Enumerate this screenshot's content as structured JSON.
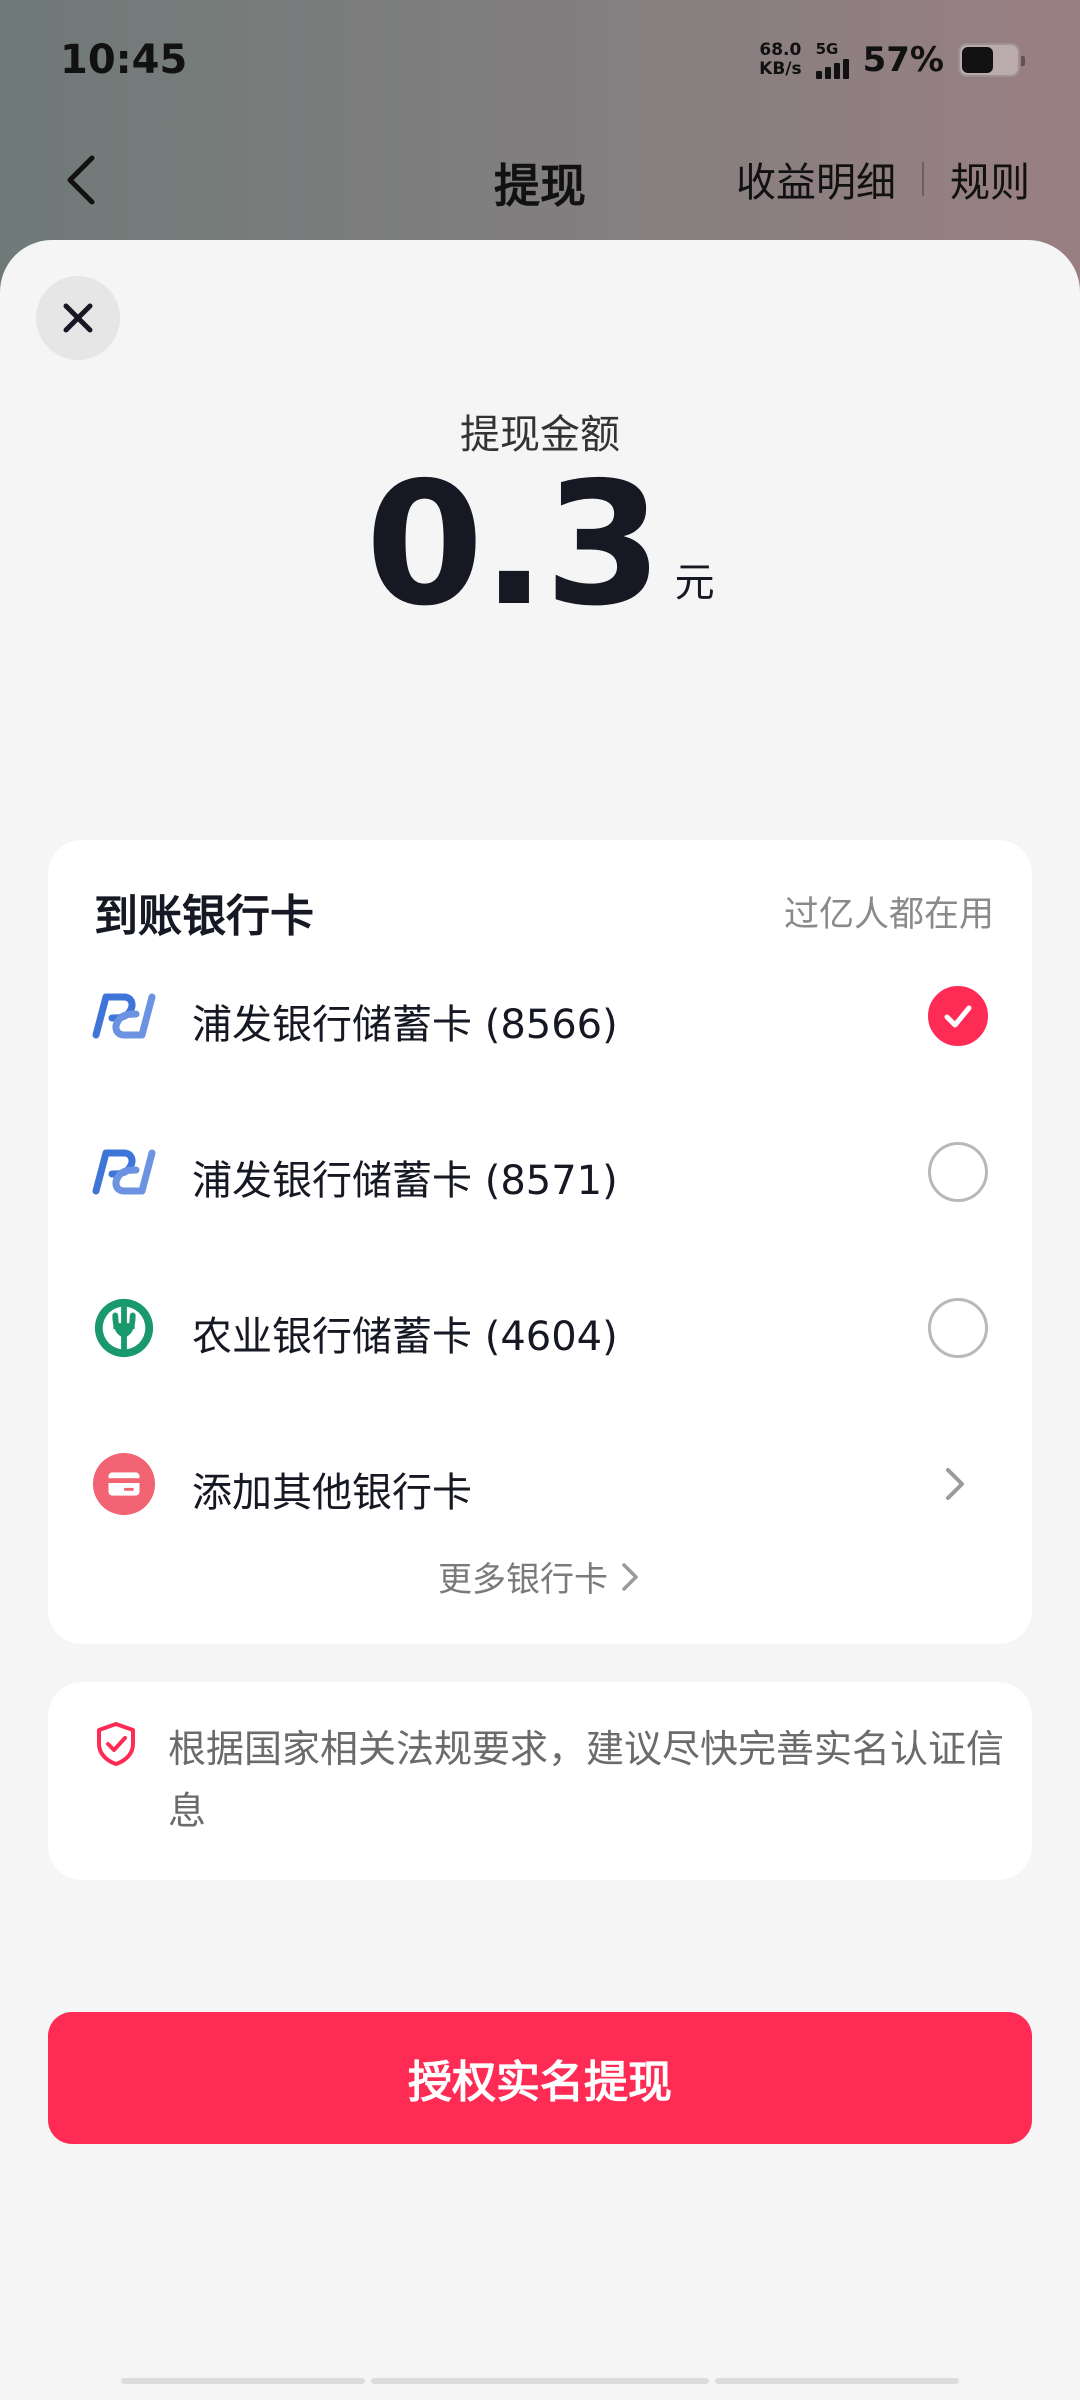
{
  "status_bar": {
    "time": "10:45",
    "net_speed_value": "68.0",
    "net_speed_unit": "KB/s",
    "signal_label": "5G",
    "battery_percent": "57%",
    "battery_level": 0.57
  },
  "nav": {
    "title": "提现",
    "earnings_detail": "收益明细",
    "rules": "规则"
  },
  "withdraw": {
    "amount_label": "提现金额",
    "amount": "0.3",
    "unit": "元"
  },
  "bank_panel": {
    "title": "到账银行卡",
    "subtitle": "过亿人都在用",
    "cards": [
      {
        "name": "浦发银行储蓄卡 (8566)",
        "icon": "spdb-bank-icon",
        "selected": true
      },
      {
        "name": "浦发银行储蓄卡 (8571)",
        "icon": "spdb-bank-icon",
        "selected": false
      },
      {
        "name": "农业银行储蓄卡 (4604)",
        "icon": "abc-bank-icon",
        "selected": false
      }
    ],
    "add_card": "添加其他银行卡",
    "more_cards": "更多银行卡"
  },
  "notice": {
    "text": "根据国家相关法规要求，建议尽快完善实名认证信息"
  },
  "submit_button": "授权实名提现",
  "colors": {
    "accent": "#fe2c55",
    "spdb_blue": "#3f74d8",
    "abc_green": "#1a9a6c",
    "sheet_bg": "#f5f5f5"
  }
}
